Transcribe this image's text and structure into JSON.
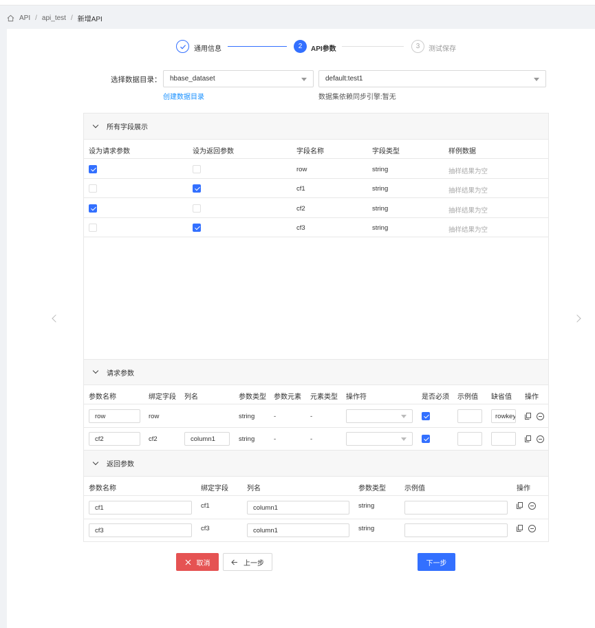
{
  "breadcrumb": {
    "items": [
      "API",
      "api_test",
      "新增API"
    ]
  },
  "steps": [
    {
      "num": "",
      "label": "通用信息",
      "state": "done"
    },
    {
      "num": "2",
      "label": "API参数",
      "state": "active"
    },
    {
      "num": "3",
      "label": "测试保存",
      "state": "pending"
    }
  ],
  "form": {
    "label": "选择数据目录：",
    "catalog_value": "hbase_dataset",
    "table_value": "default:test1",
    "create_link": "创建数据目录",
    "sync_note": "数据集依赖同步引擎:暂无"
  },
  "fields_section": {
    "title": "所有字段展示",
    "headers": [
      "设为请求参数",
      "设为返回参数",
      "字段名称",
      "字段类型",
      "样例数据"
    ],
    "rows": [
      {
        "req": true,
        "ret": false,
        "name": "row",
        "type": "string",
        "sample": "抽样结果为空"
      },
      {
        "req": false,
        "ret": true,
        "name": "cf1",
        "type": "string",
        "sample": "抽样结果为空"
      },
      {
        "req": true,
        "ret": false,
        "name": "cf2",
        "type": "string",
        "sample": "抽样结果为空"
      },
      {
        "req": false,
        "ret": true,
        "name": "cf3",
        "type": "string",
        "sample": "抽样结果为空"
      }
    ]
  },
  "request_section": {
    "title": "请求参数",
    "headers": [
      "参数名称",
      "绑定字段",
      "列名",
      "参数类型",
      "参数元素",
      "元素类型",
      "操作符",
      "是否必须",
      "示例值",
      "缺省值",
      "操作"
    ],
    "rows": [
      {
        "param": "row",
        "bind": "row",
        "column": "",
        "type": "string",
        "elem": "-",
        "elem_type": "-",
        "required": true,
        "example": "",
        "default": "rowkey"
      },
      {
        "param": "cf2",
        "bind": "cf2",
        "column": "column1",
        "type": "string",
        "elem": "-",
        "elem_type": "-",
        "required": true,
        "example": "",
        "default": ""
      }
    ]
  },
  "response_section": {
    "title": "返回参数",
    "headers": [
      "参数名称",
      "绑定字段",
      "列名",
      "参数类型",
      "示例值",
      "操作"
    ],
    "rows": [
      {
        "param": "cf1",
        "bind": "cf1",
        "column": "column1",
        "type": "string",
        "example": ""
      },
      {
        "param": "cf3",
        "bind": "cf3",
        "column": "column1",
        "type": "string",
        "example": ""
      }
    ]
  },
  "buttons": {
    "cancel": "取消",
    "prev": "上一步",
    "next": "下一步"
  },
  "colors": {
    "primary": "#3370ff",
    "danger": "#e55353",
    "link": "#1890ff"
  }
}
